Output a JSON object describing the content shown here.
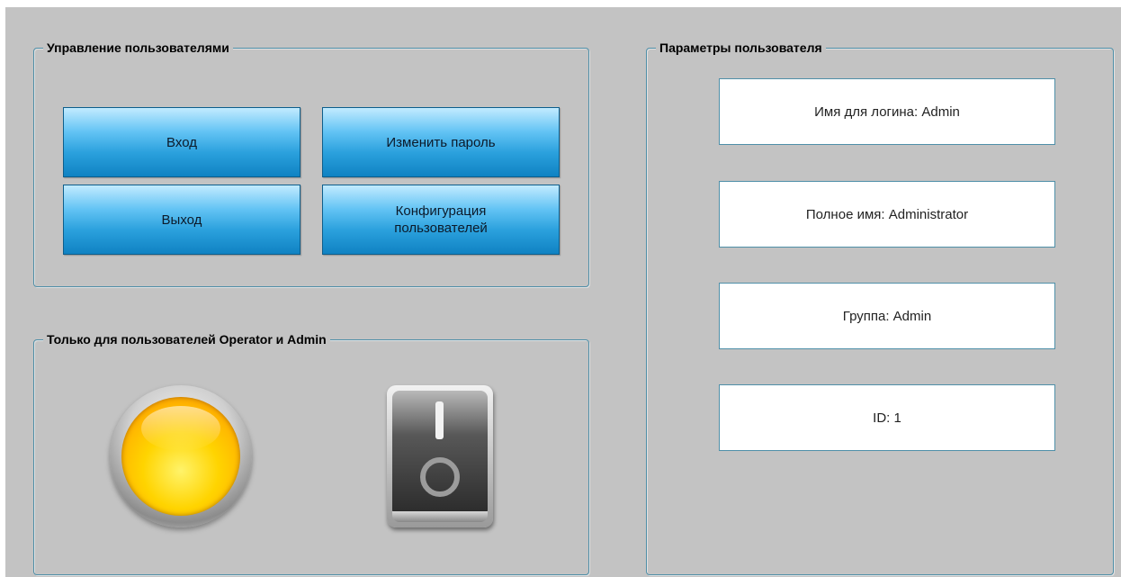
{
  "user_management": {
    "title": "Управление  пользователями",
    "buttons": {
      "login": "Вход",
      "change_password": "Изменить пароль",
      "logout": "Выход",
      "user_config": "Конфигурация\nпользователей"
    }
  },
  "restricted": {
    "title": "Только для пользователей Operator и Admin",
    "lamp_state": "on",
    "lamp_color": "#ffd400",
    "switch_state": "off"
  },
  "user_params": {
    "title": "Параметры пользователя",
    "fields": {
      "login_name": "Имя для логина: Admin",
      "full_name": "Полное имя: Administrator",
      "group": "Группа: Admin",
      "id": "ID: 1"
    }
  },
  "colors": {
    "background": "#c3c3c3",
    "group_border": "#4f8fa8",
    "button_blue": "#2ba1dd"
  }
}
